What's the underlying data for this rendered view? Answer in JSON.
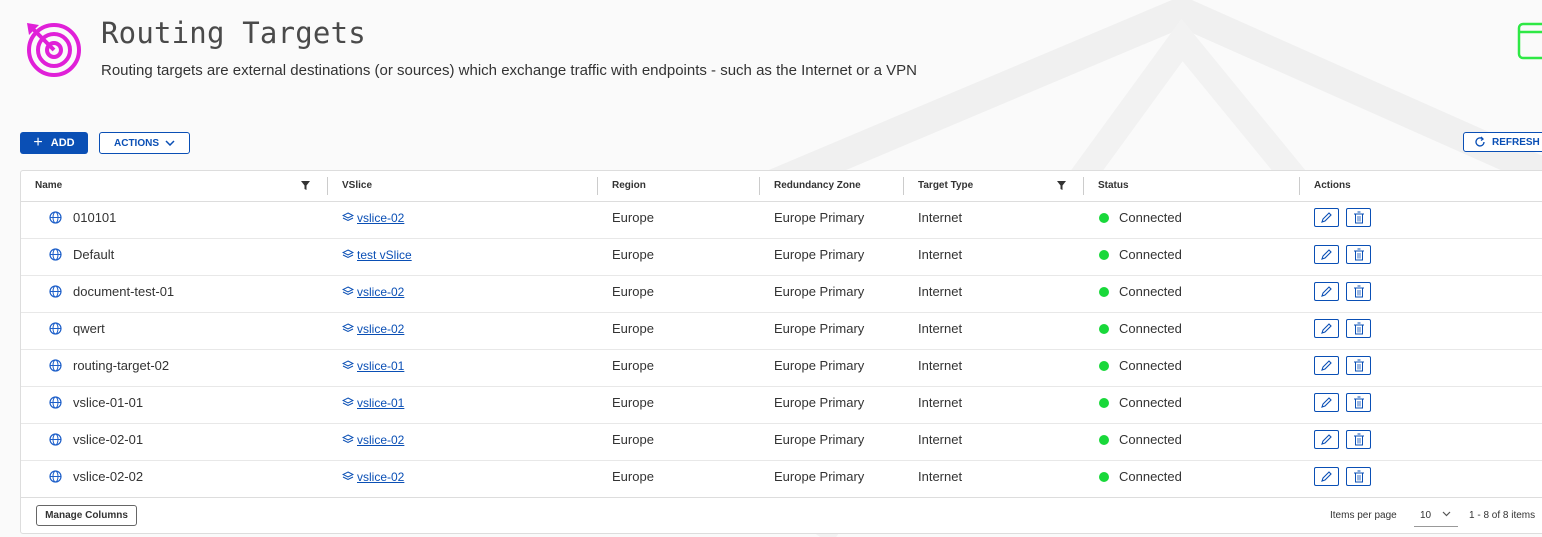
{
  "header": {
    "title": "Routing Targets",
    "subtitle": "Routing targets are external destinations (or sources) which exchange traffic with endpoints - such as the Internet or a VPN",
    "logo_icon": "target-icon",
    "accent_color": "#e020d8"
  },
  "toolbar": {
    "add_label": "ADD",
    "actions_label": "ACTIONS",
    "refresh_label": "REFRESH"
  },
  "grid": {
    "columns": [
      "Name",
      "VSlice",
      "Region",
      "Redundancy Zone",
      "Target Type",
      "Status",
      "Actions"
    ],
    "rows": [
      {
        "name": "010101",
        "vslice": "vslice-02",
        "region": "Europe",
        "zone": "Europe Primary",
        "type": "Internet",
        "status": "Connected"
      },
      {
        "name": "Default",
        "vslice": "test vSlice",
        "region": "Europe",
        "zone": "Europe Primary",
        "type": "Internet",
        "status": "Connected"
      },
      {
        "name": "document-test-01",
        "vslice": "vslice-02",
        "region": "Europe",
        "zone": "Europe Primary",
        "type": "Internet",
        "status": "Connected"
      },
      {
        "name": "qwert",
        "vslice": "vslice-02",
        "region": "Europe",
        "zone": "Europe Primary",
        "type": "Internet",
        "status": "Connected"
      },
      {
        "name": "routing-target-02",
        "vslice": "vslice-01",
        "region": "Europe",
        "zone": "Europe Primary",
        "type": "Internet",
        "status": "Connected"
      },
      {
        "name": "vslice-01-01",
        "vslice": "vslice-01",
        "region": "Europe",
        "zone": "Europe Primary",
        "type": "Internet",
        "status": "Connected"
      },
      {
        "name": "vslice-02-01",
        "vslice": "vslice-02",
        "region": "Europe",
        "zone": "Europe Primary",
        "type": "Internet",
        "status": "Connected"
      },
      {
        "name": "vslice-02-02",
        "vslice": "vslice-02",
        "region": "Europe",
        "zone": "Europe Primary",
        "type": "Internet",
        "status": "Connected"
      }
    ],
    "status_color": "#19d83a",
    "link_color": "#0a4fb5"
  },
  "footer": {
    "manage_columns_label": "Manage Columns",
    "items_per_page_label": "Items per page",
    "items_per_page_value": "10",
    "pager_text": "1 - 8 of 8 items"
  }
}
